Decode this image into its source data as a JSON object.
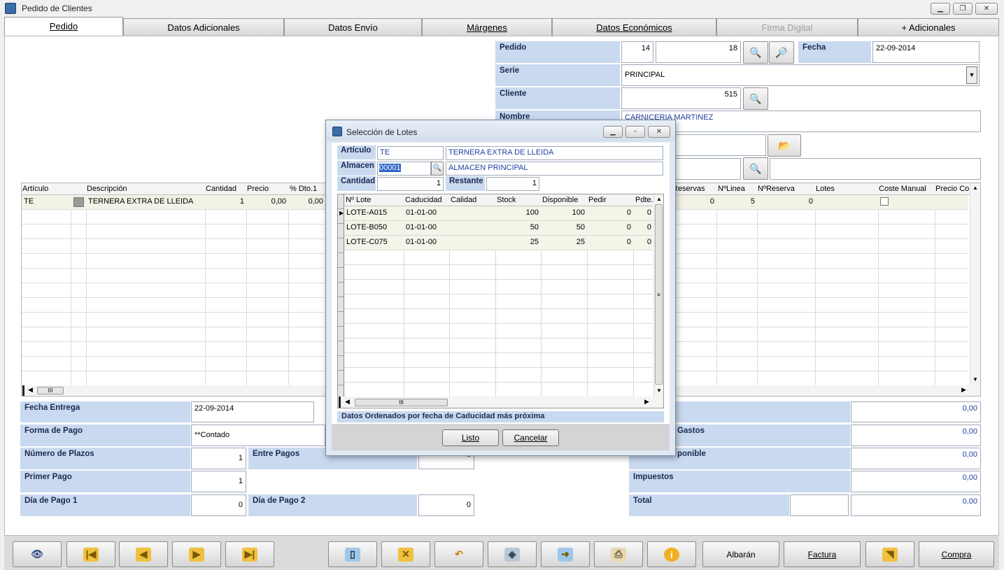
{
  "window": {
    "title": "Pedido de Clientes"
  },
  "tabs": [
    "Pedido",
    "Datos Adicionales",
    "Datos Envío",
    "Márgenes",
    "Datos Económicos",
    "Firma Digital",
    "+ Adicionales"
  ],
  "header": {
    "pedido_label": "Pedido",
    "pedido_num": "14",
    "pedido_num2": "18",
    "fecha_label": "Fecha",
    "fecha": "22-09-2014",
    "serie_label": "Serie",
    "serie": "PRINCIPAL",
    "cliente_label": "Cliente",
    "cliente": "515",
    "nombre_label": "Nombre",
    "nombre": "CARNICERIA MARTINEZ"
  },
  "grid": {
    "columns_left": [
      "Artículo",
      "Descripción",
      "Cantidad",
      "Precio",
      "% Dto.1"
    ],
    "columns_right": [
      "Reservas",
      "NºLinea",
      "NºReserva",
      "Lotes",
      "Coste Manual",
      "Precio Co"
    ],
    "row": {
      "articulo": "TE",
      "descripcion": "TERNERA EXTRA DE LLEIDA",
      "cantidad": "1",
      "precio": "0,00",
      "dto": "0,00",
      "reservas": "0",
      "linea": "5",
      "reserva": "0"
    },
    "hscroll_grip": "III"
  },
  "footer": {
    "fecha_entrega_label": "Fecha Entrega",
    "fecha_entrega": "22-09-2014",
    "forma_pago_label": "Forma de Pago",
    "forma_pago": "**Contado",
    "num_plazos_label": "Número de Plazos",
    "num_plazos": "1",
    "entre_pagos_label": "Entre Pagos",
    "entre_pagos": "0",
    "primer_pago_label": "Primer Pago",
    "primer_pago": "1",
    "dia_pago1_label": "Día de Pago 1",
    "dia_pago1": "0",
    "dia_pago2_label": "Día de Pago 2",
    "dia_pago2": "0",
    "gastos_label": "Gastos",
    "imponible_label": "ponible",
    "impuestos_label": "Impuestos",
    "total_label": "Total",
    "val1": "0,00",
    "val2": "0,00",
    "val3": "0,00",
    "val4": "0,00",
    "val5": "0,00"
  },
  "dialog": {
    "title": "Selección de Lotes",
    "articulo_label": "Artículo",
    "articulo_code": "TE",
    "articulo_desc": "TERNERA EXTRA DE LLEIDA",
    "almacen_label": "Almacen",
    "almacen_code": "00001",
    "almacen_desc": "ALMACEN PRINCIPAL",
    "cantidad_label": "Cantidad",
    "cantidad": "1",
    "restante_label": "Restante",
    "restante": "1",
    "columns": [
      "Nº Lote",
      "Caducidad",
      "Calidad",
      "Stock",
      "Disponible",
      "Pedir",
      "Pdte."
    ],
    "rows": [
      {
        "lote": "LOTE-A015",
        "caducidad": "01-01-00",
        "calidad": "",
        "stock": "100",
        "disponible": "100",
        "pedir": "0",
        "pdte": "0"
      },
      {
        "lote": "LOTE-B050",
        "caducidad": "01-01-00",
        "calidad": "",
        "stock": "50",
        "disponible": "50",
        "pedir": "0",
        "pdte": "0"
      },
      {
        "lote": "LOTE-C075",
        "caducidad": "01-01-00",
        "calidad": "",
        "stock": "25",
        "disponible": "25",
        "pedir": "0",
        "pdte": "0"
      }
    ],
    "status": "Datos Ordenados por fecha de Caducidad más próxima",
    "listo": "Listo",
    "cancelar": "Cancelar",
    "hscroll_grip": "III"
  },
  "toolbar": {
    "albaran": "Albarán",
    "factura": "Factura",
    "compra": "Compra"
  },
  "colors": {
    "label_bg": "#c9d9ef",
    "label_text": "#1a2a50",
    "value_blue": "#1f3fa0",
    "selection": "#3064c8"
  }
}
